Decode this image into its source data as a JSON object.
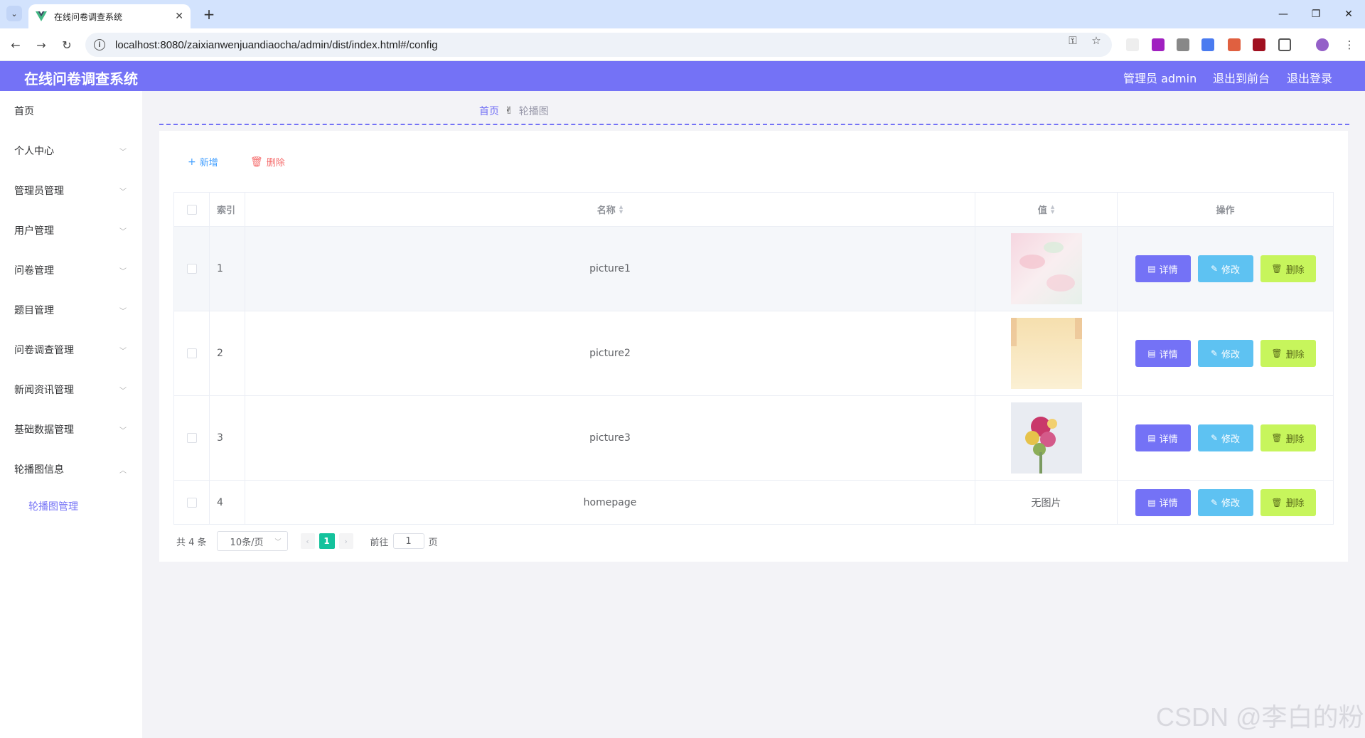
{
  "browser": {
    "tab_title": "在线问卷调查系统",
    "url": "localhost:8080/zaixianwenjuandiaocha/admin/dist/index.html#/config"
  },
  "header": {
    "title": "在线问卷调查系统",
    "user_label": "管理员 admin",
    "to_front": "退出到前台",
    "logout": "退出登录"
  },
  "sidebar": {
    "items": [
      {
        "label": "首页"
      },
      {
        "label": "个人中心"
      },
      {
        "label": "管理员管理"
      },
      {
        "label": "用户管理"
      },
      {
        "label": "问卷管理"
      },
      {
        "label": "题目管理"
      },
      {
        "label": "问卷调查管理"
      },
      {
        "label": "新闻资讯管理"
      },
      {
        "label": "基础数据管理"
      },
      {
        "label": "轮播图信息"
      }
    ],
    "sub_item": "轮播图管理"
  },
  "breadcrumb": {
    "home": "首页",
    "current": "轮播图"
  },
  "toolbar": {
    "add": "新增",
    "delete": "删除"
  },
  "table": {
    "headers": {
      "index": "索引",
      "name": "名称",
      "value": "值",
      "ops": "操作"
    },
    "rows": [
      {
        "index": "1",
        "name": "picture1"
      },
      {
        "index": "2",
        "name": "picture2"
      },
      {
        "index": "3",
        "name": "picture3"
      },
      {
        "index": "4",
        "name": "homepage",
        "value_text": "无图片"
      }
    ],
    "actions": {
      "detail": "详情",
      "edit": "修改",
      "delete": "删除"
    }
  },
  "pagination": {
    "total": "共 4 条",
    "page_size": "10条/页",
    "current_page": "1",
    "goto_label": "前往",
    "goto_value": "1",
    "page_unit": "页"
  },
  "watermark": "CSDN @李白的粉",
  "colors": {
    "primary": "#7472f6",
    "edit": "#5ec2f2",
    "delete": "#c7f55c",
    "page_active": "#14c29c"
  }
}
